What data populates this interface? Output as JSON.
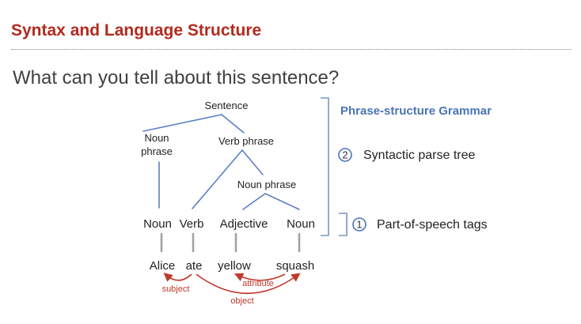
{
  "slide": {
    "title": "Syntax and Language Structure",
    "question": "What can you tell about this sentence?"
  },
  "tree": {
    "root": "Sentence",
    "noun_phrase_1": [
      "Noun",
      "phrase"
    ],
    "verb_phrase": "Verb phrase",
    "noun_phrase_2": "Noun phrase"
  },
  "pos_tags": [
    "Noun",
    "Verb",
    "Adjective",
    "Noun"
  ],
  "words": [
    "Alice",
    "ate",
    "yellow",
    "squash"
  ],
  "dependencies": [
    {
      "label": "subject",
      "from": "ate",
      "to": "Alice"
    },
    {
      "label": "attribute",
      "from": "squash",
      "to": "yellow"
    },
    {
      "label": "object",
      "from": "ate",
      "to": "squash"
    }
  ],
  "annotations": {
    "heading": "Phrase-structure Grammar",
    "parse_tree": {
      "number": "2",
      "label": "Syntactic parse tree"
    },
    "pos": {
      "number": "1",
      "label": "Part-of-speech tags"
    }
  },
  "colors": {
    "title": "#b22a1f",
    "tree_lines": "#5b7fc4",
    "word_stems": "#a0a0a0",
    "dependency_arcs": "#c0392b",
    "heading": "#4a74b8",
    "bracket": "#7a95c9"
  }
}
